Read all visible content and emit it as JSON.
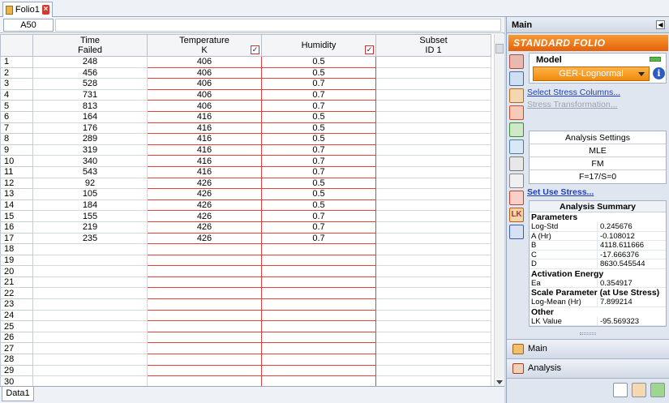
{
  "document_tab": {
    "label": "Folio1"
  },
  "name_box": "A50",
  "columns": [
    {
      "line1": "Time",
      "line2": "Failed",
      "checkbox": false
    },
    {
      "line1": "Temperature",
      "line2": "K",
      "checkbox": true
    },
    {
      "line1": "Humidity",
      "line2": "",
      "checkbox": true
    },
    {
      "line1": "Subset",
      "line2": "ID 1",
      "checkbox": false
    }
  ],
  "rows": [
    [
      "248",
      "406",
      "0.5",
      ""
    ],
    [
      "456",
      "406",
      "0.5",
      ""
    ],
    [
      "528",
      "406",
      "0.7",
      ""
    ],
    [
      "731",
      "406",
      "0.7",
      ""
    ],
    [
      "813",
      "406",
      "0.7",
      ""
    ],
    [
      "164",
      "416",
      "0.5",
      ""
    ],
    [
      "176",
      "416",
      "0.5",
      ""
    ],
    [
      "289",
      "416",
      "0.5",
      ""
    ],
    [
      "319",
      "416",
      "0.7",
      ""
    ],
    [
      "340",
      "416",
      "0.7",
      ""
    ],
    [
      "543",
      "416",
      "0.7",
      ""
    ],
    [
      "92",
      "426",
      "0.5",
      ""
    ],
    [
      "105",
      "426",
      "0.5",
      ""
    ],
    [
      "184",
      "426",
      "0.5",
      ""
    ],
    [
      "155",
      "426",
      "0.7",
      ""
    ],
    [
      "219",
      "426",
      "0.7",
      ""
    ],
    [
      "235",
      "426",
      "0.7",
      ""
    ],
    [
      "",
      "",
      "",
      ""
    ],
    [
      "",
      "",
      "",
      ""
    ],
    [
      "",
      "",
      "",
      ""
    ],
    [
      "",
      "",
      "",
      ""
    ],
    [
      "",
      "",
      "",
      ""
    ],
    [
      "",
      "",
      "",
      ""
    ],
    [
      "",
      "",
      "",
      ""
    ],
    [
      "",
      "",
      "",
      ""
    ],
    [
      "",
      "",
      "",
      ""
    ],
    [
      "",
      "",
      "",
      ""
    ],
    [
      "",
      "",
      "",
      ""
    ],
    [
      "",
      "",
      "",
      ""
    ],
    [
      "",
      "",
      "",
      ""
    ]
  ],
  "sheet_tab": "Data1",
  "panel": {
    "title": "Main",
    "banner": "STANDARD FOLIO",
    "model_label": "Model",
    "model_value": "GER-Lognormal",
    "select_stress_link": "Select Stress Columns...",
    "stress_transform_link": "Stress Transformation...",
    "settings": [
      "Analysis Settings",
      "MLE",
      "FM",
      "F=17/S=0"
    ],
    "use_stress_link": "Set Use Stress...",
    "summary": {
      "title": "Analysis Summary",
      "sections": [
        {
          "heading": "Parameters",
          "rows": [
            [
              "Log-Std",
              "0.245676"
            ],
            [
              "A (Hr)",
              "-0.108012"
            ],
            [
              "B",
              "4118.611666"
            ],
            [
              "C",
              "-17.666376"
            ],
            [
              "D",
              "8630.545544"
            ]
          ]
        },
        {
          "heading": "Activation Energy",
          "rows": [
            [
              "Ea",
              "0.354917"
            ]
          ]
        },
        {
          "heading": "Scale Parameter (at Use Stress)",
          "rows": [
            [
              "Log-Mean (Hr)",
              "7.899214"
            ]
          ]
        },
        {
          "heading": "Other",
          "rows": [
            [
              "LK Value",
              "-95.569323"
            ]
          ]
        }
      ]
    },
    "nav_main": "Main",
    "nav_analysis": "Analysis"
  },
  "colors": {
    "accent_orange": "#f08a0e",
    "highlight_red": "#e04040",
    "panel_bg": "#dfe6ef"
  }
}
